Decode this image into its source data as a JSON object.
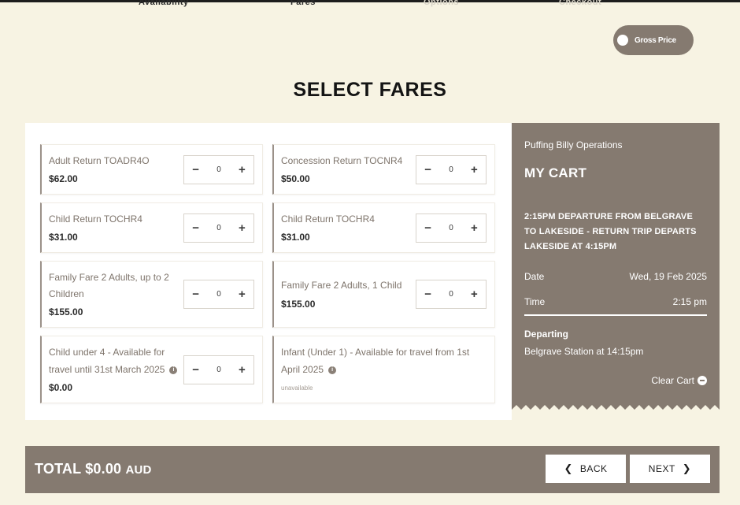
{
  "steps": [
    {
      "label": "Availability",
      "state": "done"
    },
    {
      "label": "Fares",
      "state": "active"
    },
    {
      "label": "Options",
      "state": "upcoming"
    },
    {
      "label": "Checkout",
      "state": "upcoming"
    }
  ],
  "price_toggle": {
    "label": "Gross Price"
  },
  "page_title": "SELECT FARES",
  "fares": [
    {
      "name": "Adult Return TOADR4O",
      "price": "$62.00",
      "quantity": "0"
    },
    {
      "name": "Concession Return TOCNR4",
      "price": "$50.00",
      "quantity": "0"
    },
    {
      "name": "Child Return TOCHR4",
      "price": "$31.00",
      "quantity": "0"
    },
    {
      "name": "Child Return TOCHR4",
      "price": "$31.00",
      "quantity": "0"
    },
    {
      "name_line1": "Family Fare 2 Adults, up to 2",
      "name_line2": "Children",
      "price": "$155.00",
      "quantity": "0"
    },
    {
      "name": "Family Fare 2 Adults, 1 Child",
      "price": "$155.00",
      "quantity": "0"
    },
    {
      "name_line1": "Child under 4 - Available for",
      "name_line2": "travel until 31st March 2025",
      "price": "$0.00",
      "quantity": "0"
    },
    {
      "name_line1": "Infant (Under 1) - Available for travel from 1st",
      "name_line2": "April 2025",
      "status": "unavailable"
    }
  ],
  "stepper": {
    "minus": "−",
    "plus": "+"
  },
  "cart": {
    "vendor": "Puffing Billy Operations",
    "title": "MY CART",
    "trip_line1": "2:15PM DEPARTURE FROM BELGRAVE",
    "trip_line2": "TO LAKESIDE - RETURN TRIP DEPARTS",
    "trip_line3": "LAKESIDE AT 4:15PM",
    "date_label": "Date",
    "date_value": "Wed, 19 Feb 2025",
    "time_label": "Time",
    "time_value": "2:15 pm",
    "departing_label": "Departing",
    "departing_value": "Belgrave Station at 14:15pm",
    "clear_label": "Clear Cart"
  },
  "footer": {
    "total_label": "TOTAL $0.00",
    "currency": "AUD",
    "back_label": "BACK",
    "next_label": "NEXT"
  }
}
